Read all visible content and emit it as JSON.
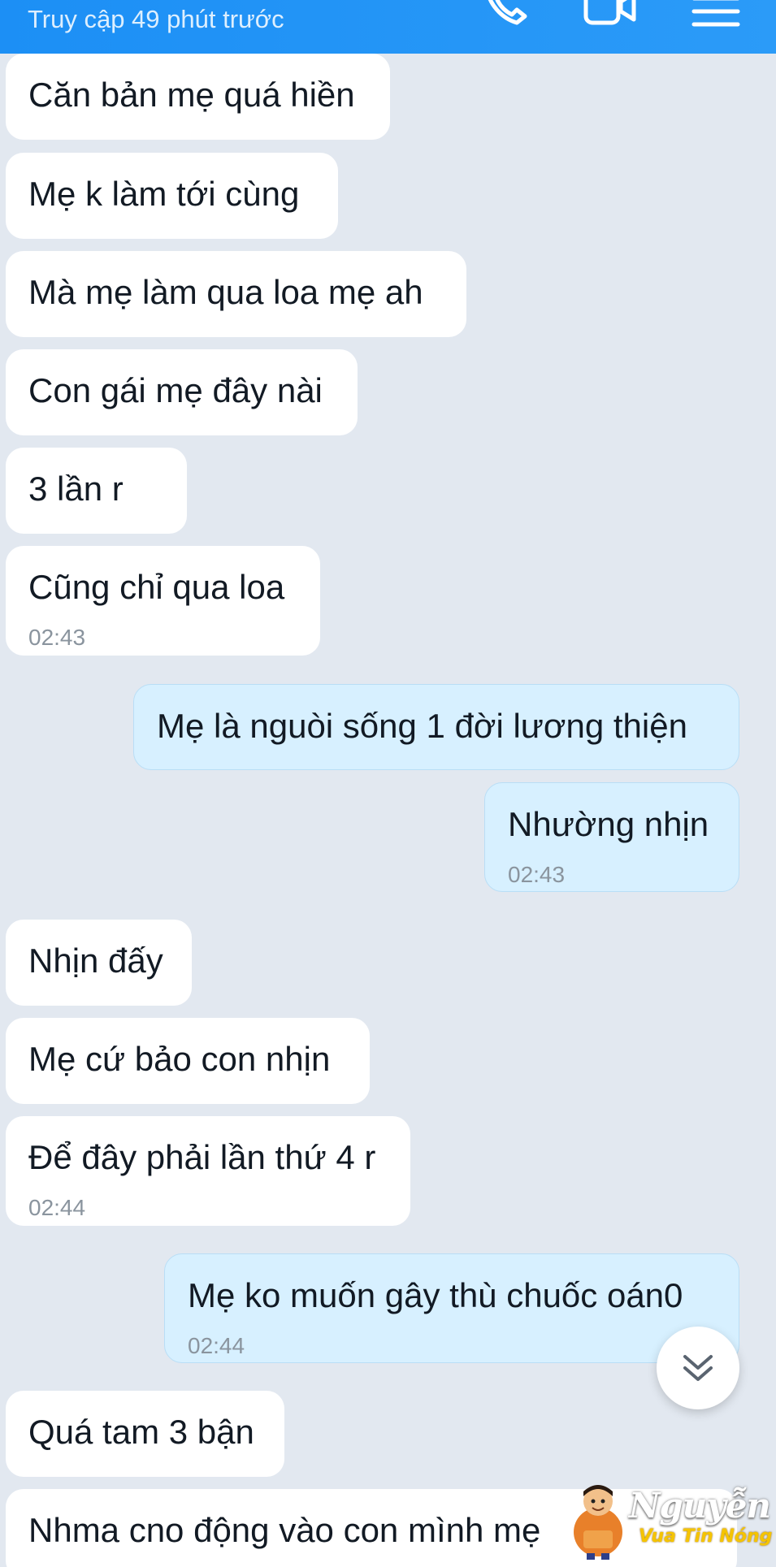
{
  "header": {
    "status": "Truy cập 49 phút trước",
    "icons": [
      "phone-icon",
      "video-call-icon",
      "menu-icon"
    ],
    "color": "#1c8ff5"
  },
  "messages": [
    {
      "side": "in",
      "text": "Căn bản mẹ quá hiền"
    },
    {
      "side": "in",
      "text": "Mẹ k làm tới cùng"
    },
    {
      "side": "in",
      "text": "Mà mẹ làm qua loa mẹ ah"
    },
    {
      "side": "in",
      "text": "Con gái mẹ đây nài"
    },
    {
      "side": "in",
      "text": "3 lần r"
    },
    {
      "side": "in",
      "text": "Cũng chỉ qua loa",
      "time": "02:43"
    },
    {
      "side": "out",
      "text": "Mẹ là nguòi sống 1 đời lương thiện"
    },
    {
      "side": "out",
      "text": "Nhường nhịn",
      "time": "02:43"
    },
    {
      "side": "in",
      "text": "Nhịn đấy"
    },
    {
      "side": "in",
      "text": "Mẹ cứ bảo con nhịn"
    },
    {
      "side": "in",
      "text": "Để đây phải lần thứ 4 r",
      "time": "02:44"
    },
    {
      "side": "out",
      "text": "Mẹ ko muốn gây thù chuốc oán0",
      "time": "02:44"
    },
    {
      "side": "in",
      "text": "Quá tam 3 bận"
    },
    {
      "side": "in",
      "text": "Nhma cno động vào con mình mẹ"
    }
  ],
  "colors": {
    "incoming_bubble": "#ffffff",
    "outgoing_bubble": "#d7f0ff",
    "background": "#e2e8f0"
  },
  "scroll_button": {
    "icon": "double-chevron-down-icon"
  },
  "watermark": {
    "name": "Nguyễn Sin",
    "tagline": "Vua Tin Nóng"
  }
}
